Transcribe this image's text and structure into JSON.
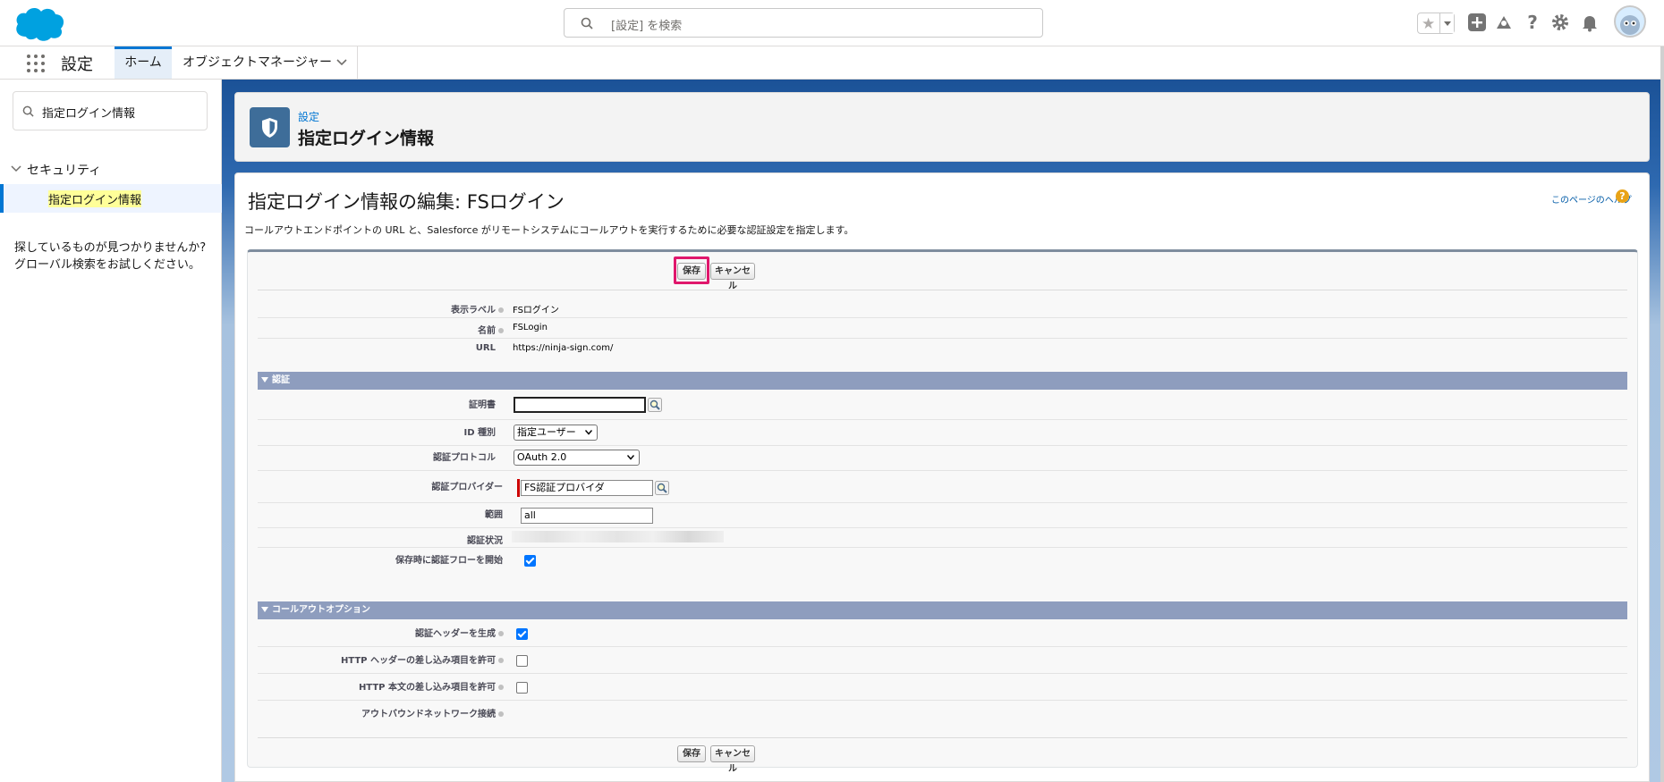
{
  "header": {
    "search_placeholder": "[設定] を検索"
  },
  "nav": {
    "app_name": "設定",
    "tabs": [
      {
        "label": "ホーム",
        "active": true
      },
      {
        "label": "オブジェクトマネージャー",
        "active": false
      }
    ]
  },
  "sidebar": {
    "quick_find_value": "指定ログイン情報",
    "section_label": "セキュリティ",
    "selected_item": "指定ログイン情報",
    "help_line1": "探しているものが見つかりませんか?",
    "help_line2": "グローバル検索をお試しください。"
  },
  "page_header": {
    "breadcrumb": "設定",
    "title": "指定ログイン情報"
  },
  "main": {
    "title": "指定ログイン情報の編集: FSログイン",
    "help_link": "このページのヘルプ",
    "help_icon": "?",
    "description": "コールアウトエンドポイントの URL と、Salesforce がリモートシステムにコールアウトを実行するために必要な認証設定を指定します。",
    "save_label": "保存",
    "cancel_label": "キャンセル"
  },
  "fields": {
    "display_label": {
      "label": "表示ラベル",
      "value": "FSログイン"
    },
    "name": {
      "label": "名前",
      "value": "FSLogin"
    },
    "url": {
      "label": "URL",
      "value": "https://ninja-sign.com/"
    }
  },
  "auth_section": {
    "title": "認証",
    "certificate": {
      "label": "証明書",
      "value": ""
    },
    "identity_type": {
      "label": "ID 種別",
      "value": "指定ユーザー"
    },
    "auth_protocol": {
      "label": "認証プロトコル",
      "value": "OAuth 2.0"
    },
    "auth_provider": {
      "label": "認証プロバイダー",
      "value": "FS認証プロバイダ"
    },
    "scope": {
      "label": "範囲",
      "value": "all"
    },
    "auth_status": {
      "label": "認証状況"
    },
    "start_auth_flow": {
      "label": "保存時に認証フローを開始",
      "checked": true
    }
  },
  "callout_section": {
    "title": "コールアウトオプション",
    "generate_auth_header": {
      "label": "認証ヘッダーを生成",
      "checked": true
    },
    "allow_merge_header": {
      "label": "HTTP ヘッダーの差し込み項目を許可",
      "checked": false
    },
    "allow_merge_body": {
      "label": "HTTP 本文の差し込み項目を許可",
      "checked": false
    },
    "outbound_network": {
      "label": "アウトバウンドネットワーク接続"
    }
  },
  "colors": {
    "brand": "#0176d3",
    "section_header": "#8e9dbe",
    "highlight_border": "#e0176c"
  }
}
